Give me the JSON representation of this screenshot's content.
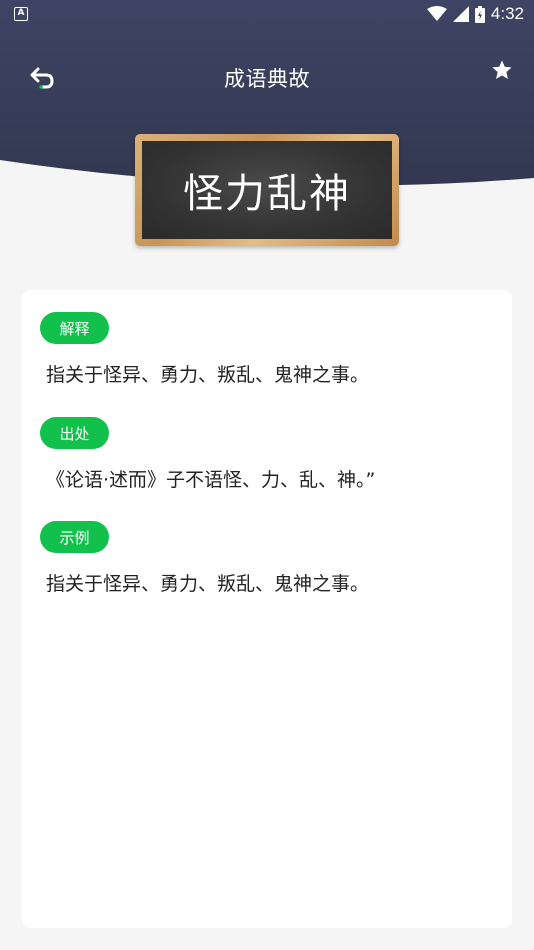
{
  "status_bar": {
    "app_icon": "A",
    "time": "4:32"
  },
  "nav": {
    "title": "成语典故",
    "back_icon": "back-arrow-icon",
    "star_icon": "star-icon"
  },
  "colors": {
    "header": "#3a3f5c",
    "accent_green": "#12c14c",
    "card": "#ffffff",
    "page_bg": "#f5f5f5"
  },
  "idiom": {
    "word": "怪力乱神"
  },
  "sections": [
    {
      "tag": "解释",
      "text": "指关于怪异、勇力、叛乱、鬼神之事。"
    },
    {
      "tag": "出处",
      "text": "《论语·述而》子不语怪、力、乱、神。”"
    },
    {
      "tag": "示例",
      "text": "指关于怪异、勇力、叛乱、鬼神之事。"
    }
  ]
}
